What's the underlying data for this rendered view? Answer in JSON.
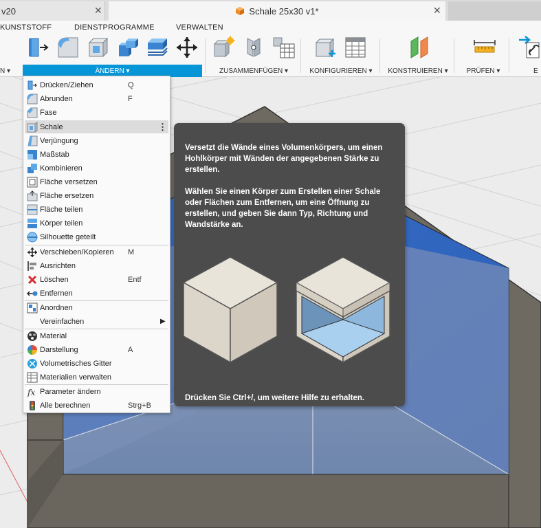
{
  "tabs": {
    "left": "v20",
    "active": "Schale 25x30 v1*",
    "close_glyph": "✕"
  },
  "ribbon_tabs": [
    "KUNSTSTOFF",
    "DIENSTPROGRAMME",
    "VERWALTEN"
  ],
  "groups": {
    "left_partial": "N ▾",
    "aendern": "ÄNDERN ▾",
    "zusammenfuegen": "ZUSAMMENFÜGEN ▾",
    "konfigurieren": "KONFIGURIEREN ▾",
    "konstruieren": "KONSTRUIEREN ▾",
    "pruefen": "PRÜFEN ▾",
    "right_partial": "E"
  },
  "menu": {
    "items": [
      {
        "label": "Drücken/Ziehen",
        "shortcut": "Q",
        "icon": "press-pull-icon"
      },
      {
        "label": "Abrunden",
        "shortcut": "F",
        "icon": "fillet-icon"
      },
      {
        "label": "Fase",
        "shortcut": "",
        "icon": "chamfer-icon"
      },
      {
        "label": "Schale",
        "shortcut": "",
        "icon": "shell-icon",
        "more": "⋮"
      },
      {
        "label": "Verjüngung",
        "shortcut": "",
        "icon": "draft-icon"
      },
      {
        "label": "Maßstab",
        "shortcut": "",
        "icon": "scale-icon"
      },
      {
        "label": "Kombinieren",
        "shortcut": "",
        "icon": "combine-icon"
      },
      {
        "label": "Fläche versetzen",
        "shortcut": "",
        "icon": "offset-face-icon"
      },
      {
        "label": "Fläche ersetzen",
        "shortcut": "",
        "icon": "replace-face-icon"
      },
      {
        "label": "Fläche teilen",
        "shortcut": "",
        "icon": "split-face-icon"
      },
      {
        "label": "Körper teilen",
        "shortcut": "",
        "icon": "split-body-icon"
      },
      {
        "label": "Silhouette geteilt",
        "shortcut": "",
        "icon": "silhouette-split-icon"
      },
      {
        "label": "Verschieben/Kopieren",
        "shortcut": "M",
        "icon": "move-icon"
      },
      {
        "label": "Ausrichten",
        "shortcut": "",
        "icon": "align-icon"
      },
      {
        "label": "Löschen",
        "shortcut": "Entf",
        "icon": "delete-icon"
      },
      {
        "label": "Entfernen",
        "shortcut": "",
        "icon": "remove-icon"
      },
      {
        "label": "Anordnen",
        "shortcut": "",
        "icon": "arrange-icon"
      },
      {
        "label": "Vereinfachen",
        "shortcut": "",
        "icon": "simplify-icon",
        "submenu": "▶"
      },
      {
        "label": "Material",
        "shortcut": "",
        "icon": "material-icon"
      },
      {
        "label": "Darstellung",
        "shortcut": "A",
        "icon": "appearance-icon"
      },
      {
        "label": "Volumetrisches Gitter",
        "shortcut": "",
        "icon": "volumetric-lattice-icon"
      },
      {
        "label": "Materialien verwalten",
        "shortcut": "",
        "icon": "manage-materials-icon"
      },
      {
        "label": "Parameter ändern",
        "shortcut": "",
        "icon": "parameters-icon"
      },
      {
        "label": "Alle berechnen",
        "shortcut": "Strg+B",
        "icon": "compute-all-icon"
      }
    ]
  },
  "tooltip": {
    "para1": "Versetzt die Wände eines Volumenkörpers, um einen Hohlkörper mit Wänden der angegebenen Stärke zu erstellen.",
    "para2": "Wählen Sie einen Körper zum Erstellen einer Schale oder Flächen zum Entfernen, um eine Öffnung zu erstellen, und geben Sie dann Typ, Richtung und Wandstärke an.",
    "footer": "Drücken Sie Ctrl+/, um weitere Hilfe zu erhalten."
  },
  "colors": {
    "accent": "#0696d7",
    "tooltip_bg": "#4c4c4c",
    "shell_inner_blue": "#3a6fc8",
    "shell_wall": "#6e6a62"
  }
}
